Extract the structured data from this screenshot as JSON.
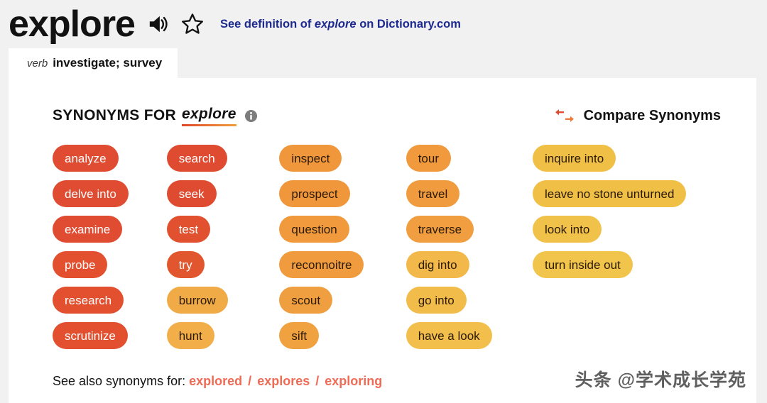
{
  "header": {
    "headword": "explore",
    "speaker_icon": "speaker-icon",
    "star_icon": "star-outline-icon",
    "definition_link_prefix": "See definition of ",
    "definition_link_word": "explore",
    "definition_link_suffix": " on Dictionary.com"
  },
  "pos_tab": {
    "pos": "verb",
    "meaning": "investigate; survey"
  },
  "synonyms_header": {
    "title": "SYNONYMS FOR",
    "word": "explore",
    "info_icon": "info-icon",
    "compare_icon": "compare-arrows-icon",
    "compare_label": "Compare Synonyms"
  },
  "colors": {
    "red": "#e04c32",
    "red_orange": "#e6572f",
    "orange_strong": "#ef8a30",
    "orange": "#f0973c",
    "orange_light": "#f2a845",
    "gold": "#f0bf46",
    "gold_light": "#f2c64e",
    "link_blue": "#1c2a8f",
    "link_salmon": "#ef6b55",
    "page_bg": "#f1f1f1",
    "card_bg": "#ffffff"
  },
  "columns": [
    {
      "name": "column-1",
      "pills": [
        {
          "label": "analyze",
          "bg": "#e04c32",
          "text": "light"
        },
        {
          "label": "delve into",
          "bg": "#e04c32",
          "text": "light"
        },
        {
          "label": "examine",
          "bg": "#e04c32",
          "text": "light"
        },
        {
          "label": "probe",
          "bg": "#e2502f",
          "text": "light"
        },
        {
          "label": "research",
          "bg": "#e2502f",
          "text": "light"
        },
        {
          "label": "scrutinize",
          "bg": "#e2502f",
          "text": "light"
        }
      ]
    },
    {
      "name": "column-2",
      "pills": [
        {
          "label": "search",
          "bg": "#df4b31",
          "text": "light"
        },
        {
          "label": "seek",
          "bg": "#df4b31",
          "text": "light"
        },
        {
          "label": "test",
          "bg": "#e1512f",
          "text": "light"
        },
        {
          "label": "try",
          "bg": "#e2562f",
          "text": "light"
        },
        {
          "label": "burrow",
          "bg": "#f0ab47",
          "text": "dark"
        },
        {
          "label": "hunt",
          "bg": "#f1ae49",
          "text": "dark"
        }
      ]
    },
    {
      "name": "column-3",
      "pills": [
        {
          "label": "inspect",
          "bg": "#f0973c",
          "text": "dark"
        },
        {
          "label": "prospect",
          "bg": "#f0973c",
          "text": "dark"
        },
        {
          "label": "question",
          "bg": "#f09a3d",
          "text": "dark"
        },
        {
          "label": "reconnoitre",
          "bg": "#f09c3e",
          "text": "dark"
        },
        {
          "label": "scout",
          "bg": "#f09f40",
          "text": "dark"
        },
        {
          "label": "sift",
          "bg": "#f0a241",
          "text": "dark"
        }
      ]
    },
    {
      "name": "column-4",
      "pills": [
        {
          "label": "tour",
          "bg": "#f0993d",
          "text": "dark"
        },
        {
          "label": "travel",
          "bg": "#f09b3e",
          "text": "dark"
        },
        {
          "label": "traverse",
          "bg": "#f09e3f",
          "text": "dark"
        },
        {
          "label": "dig into",
          "bg": "#f2b94a",
          "text": "dark"
        },
        {
          "label": "go into",
          "bg": "#f2bc4b",
          "text": "dark"
        },
        {
          "label": "have a look",
          "bg": "#f2bf4d",
          "text": "dark"
        }
      ]
    },
    {
      "name": "column-5",
      "pills": [
        {
          "label": "inquire into",
          "bg": "#f0bf46",
          "text": "dark"
        },
        {
          "label": "leave no stone unturned",
          "bg": "#f0bf46",
          "text": "dark"
        },
        {
          "label": "look into",
          "bg": "#f1c249",
          "text": "dark"
        },
        {
          "label": "turn inside out",
          "bg": "#f1c44b",
          "text": "dark"
        }
      ]
    }
  ],
  "footer": {
    "see_also_label": "See also synonyms for:",
    "separator": "/",
    "links": [
      "explored",
      "explores",
      "exploring"
    ]
  },
  "watermark": {
    "text": "头条 @学术成长学苑"
  }
}
